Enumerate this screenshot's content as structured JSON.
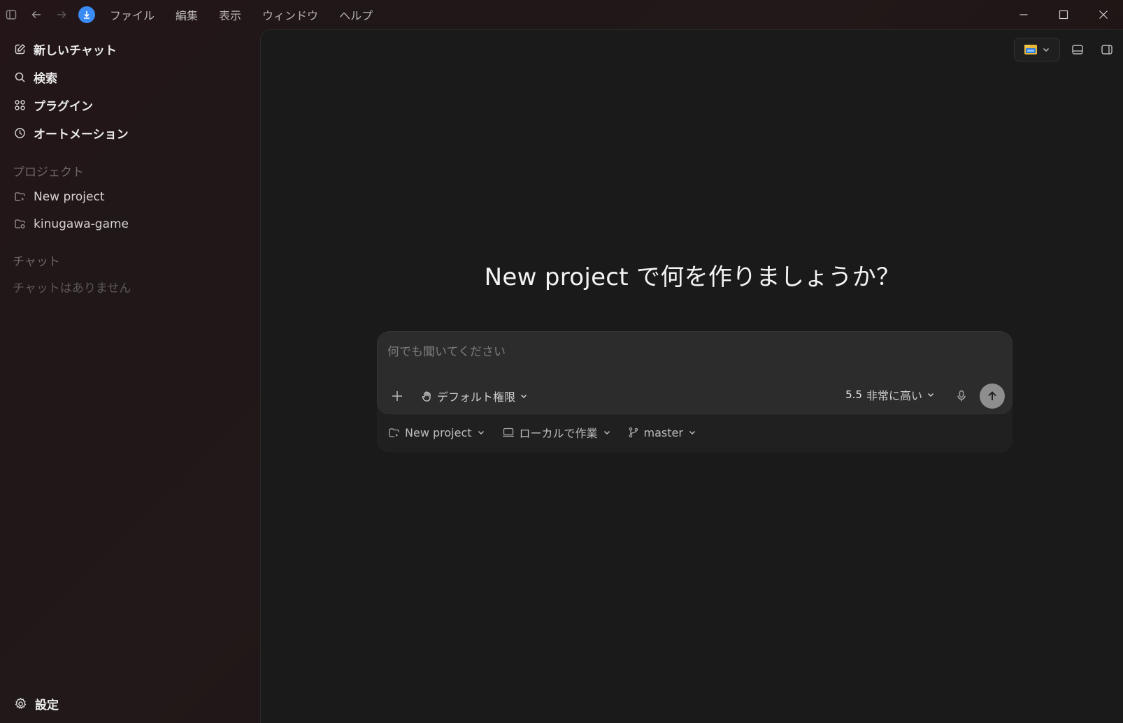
{
  "menu": {
    "items": [
      "ファイル",
      "編集",
      "表示",
      "ウィンドウ",
      "ヘルプ"
    ]
  },
  "sidebar": {
    "nav": [
      {
        "label": "新しいチャット",
        "icon": "edit-icon"
      },
      {
        "label": "検索",
        "icon": "search-icon"
      },
      {
        "label": "プラグイン",
        "icon": "grid-icon"
      },
      {
        "label": "オートメーション",
        "icon": "clock-icon"
      }
    ],
    "projects_label": "プロジェクト",
    "projects": [
      {
        "label": "New project",
        "icon": "folder-icon"
      },
      {
        "label": "kinugawa-game",
        "icon": "folder-icon"
      }
    ],
    "chats_label": "チャット",
    "chats_empty": "チャットはありません",
    "settings_label": "設定"
  },
  "main": {
    "heading": "New project で何を作りましょうか？",
    "composer": {
      "placeholder": "何でも聞いてください",
      "permission_label": "デフォルト権限",
      "model_version": "5.5",
      "model_effort": "非常に高い"
    },
    "sub_bar": {
      "project_label": "New project",
      "mode_label": "ローカルで作業",
      "branch_label": "master"
    }
  },
  "colors": {
    "accent": "#3a8bf5",
    "send_button": "#8e8e8e",
    "main_bg": "#1a1a1a"
  }
}
